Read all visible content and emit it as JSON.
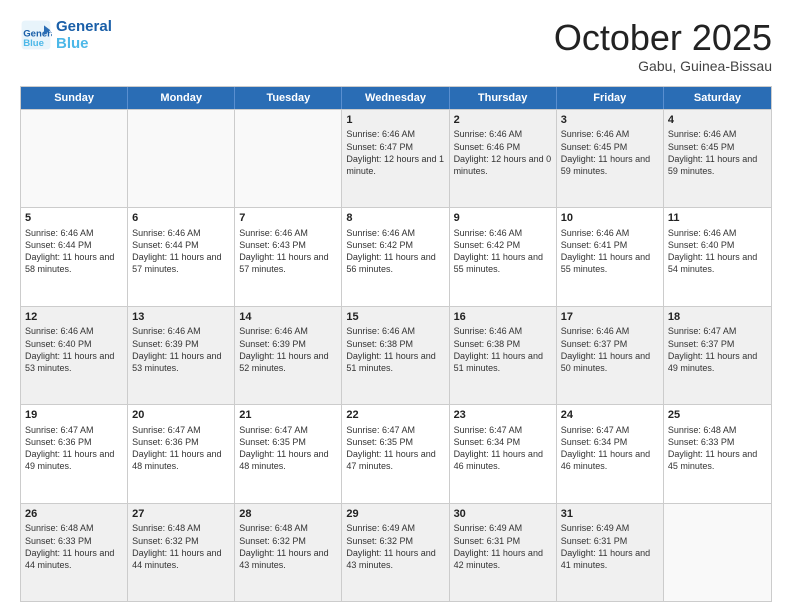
{
  "header": {
    "logo_line1": "General",
    "logo_line2": "Blue",
    "month_title": "October 2025",
    "location": "Gabu, Guinea-Bissau"
  },
  "days_of_week": [
    "Sunday",
    "Monday",
    "Tuesday",
    "Wednesday",
    "Thursday",
    "Friday",
    "Saturday"
  ],
  "rows": [
    [
      {
        "day": "",
        "info": "",
        "empty": true
      },
      {
        "day": "",
        "info": "",
        "empty": true
      },
      {
        "day": "",
        "info": "",
        "empty": true
      },
      {
        "day": "1",
        "info": "Sunrise: 6:46 AM\nSunset: 6:47 PM\nDaylight: 12 hours and 1 minute."
      },
      {
        "day": "2",
        "info": "Sunrise: 6:46 AM\nSunset: 6:46 PM\nDaylight: 12 hours and 0 minutes."
      },
      {
        "day": "3",
        "info": "Sunrise: 6:46 AM\nSunset: 6:45 PM\nDaylight: 11 hours and 59 minutes."
      },
      {
        "day": "4",
        "info": "Sunrise: 6:46 AM\nSunset: 6:45 PM\nDaylight: 11 hours and 59 minutes."
      }
    ],
    [
      {
        "day": "5",
        "info": "Sunrise: 6:46 AM\nSunset: 6:44 PM\nDaylight: 11 hours and 58 minutes."
      },
      {
        "day": "6",
        "info": "Sunrise: 6:46 AM\nSunset: 6:44 PM\nDaylight: 11 hours and 57 minutes."
      },
      {
        "day": "7",
        "info": "Sunrise: 6:46 AM\nSunset: 6:43 PM\nDaylight: 11 hours and 57 minutes."
      },
      {
        "day": "8",
        "info": "Sunrise: 6:46 AM\nSunset: 6:42 PM\nDaylight: 11 hours and 56 minutes."
      },
      {
        "day": "9",
        "info": "Sunrise: 6:46 AM\nSunset: 6:42 PM\nDaylight: 11 hours and 55 minutes."
      },
      {
        "day": "10",
        "info": "Sunrise: 6:46 AM\nSunset: 6:41 PM\nDaylight: 11 hours and 55 minutes."
      },
      {
        "day": "11",
        "info": "Sunrise: 6:46 AM\nSunset: 6:40 PM\nDaylight: 11 hours and 54 minutes."
      }
    ],
    [
      {
        "day": "12",
        "info": "Sunrise: 6:46 AM\nSunset: 6:40 PM\nDaylight: 11 hours and 53 minutes."
      },
      {
        "day": "13",
        "info": "Sunrise: 6:46 AM\nSunset: 6:39 PM\nDaylight: 11 hours and 53 minutes."
      },
      {
        "day": "14",
        "info": "Sunrise: 6:46 AM\nSunset: 6:39 PM\nDaylight: 11 hours and 52 minutes."
      },
      {
        "day": "15",
        "info": "Sunrise: 6:46 AM\nSunset: 6:38 PM\nDaylight: 11 hours and 51 minutes."
      },
      {
        "day": "16",
        "info": "Sunrise: 6:46 AM\nSunset: 6:38 PM\nDaylight: 11 hours and 51 minutes."
      },
      {
        "day": "17",
        "info": "Sunrise: 6:46 AM\nSunset: 6:37 PM\nDaylight: 11 hours and 50 minutes."
      },
      {
        "day": "18",
        "info": "Sunrise: 6:47 AM\nSunset: 6:37 PM\nDaylight: 11 hours and 49 minutes."
      }
    ],
    [
      {
        "day": "19",
        "info": "Sunrise: 6:47 AM\nSunset: 6:36 PM\nDaylight: 11 hours and 49 minutes."
      },
      {
        "day": "20",
        "info": "Sunrise: 6:47 AM\nSunset: 6:36 PM\nDaylight: 11 hours and 48 minutes."
      },
      {
        "day": "21",
        "info": "Sunrise: 6:47 AM\nSunset: 6:35 PM\nDaylight: 11 hours and 48 minutes."
      },
      {
        "day": "22",
        "info": "Sunrise: 6:47 AM\nSunset: 6:35 PM\nDaylight: 11 hours and 47 minutes."
      },
      {
        "day": "23",
        "info": "Sunrise: 6:47 AM\nSunset: 6:34 PM\nDaylight: 11 hours and 46 minutes."
      },
      {
        "day": "24",
        "info": "Sunrise: 6:47 AM\nSunset: 6:34 PM\nDaylight: 11 hours and 46 minutes."
      },
      {
        "day": "25",
        "info": "Sunrise: 6:48 AM\nSunset: 6:33 PM\nDaylight: 11 hours and 45 minutes."
      }
    ],
    [
      {
        "day": "26",
        "info": "Sunrise: 6:48 AM\nSunset: 6:33 PM\nDaylight: 11 hours and 44 minutes."
      },
      {
        "day": "27",
        "info": "Sunrise: 6:48 AM\nSunset: 6:32 PM\nDaylight: 11 hours and 44 minutes."
      },
      {
        "day": "28",
        "info": "Sunrise: 6:48 AM\nSunset: 6:32 PM\nDaylight: 11 hours and 43 minutes."
      },
      {
        "day": "29",
        "info": "Sunrise: 6:49 AM\nSunset: 6:32 PM\nDaylight: 11 hours and 43 minutes."
      },
      {
        "day": "30",
        "info": "Sunrise: 6:49 AM\nSunset: 6:31 PM\nDaylight: 11 hours and 42 minutes."
      },
      {
        "day": "31",
        "info": "Sunrise: 6:49 AM\nSunset: 6:31 PM\nDaylight: 11 hours and 41 minutes."
      },
      {
        "day": "",
        "info": "",
        "empty": true
      }
    ]
  ]
}
